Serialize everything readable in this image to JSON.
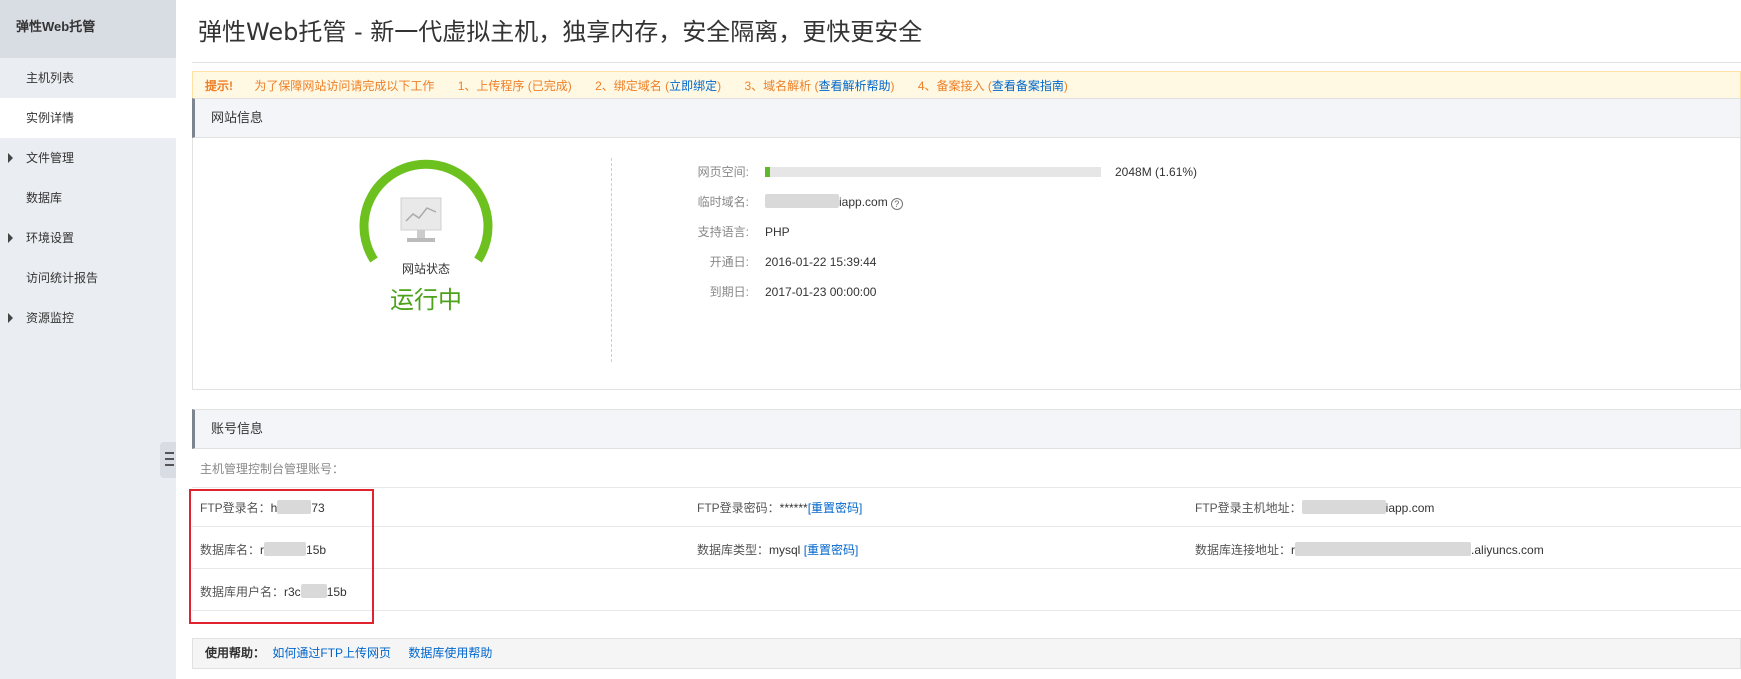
{
  "sidebar": {
    "title": "弹性Web托管",
    "items": [
      {
        "label": "主机列表",
        "caret": false,
        "active": false
      },
      {
        "label": "实例详情",
        "caret": false,
        "active": true
      },
      {
        "label": "文件管理",
        "caret": true,
        "active": false
      },
      {
        "label": "数据库",
        "caret": false,
        "active": false
      },
      {
        "label": "环境设置",
        "caret": true,
        "active": false
      },
      {
        "label": "访问统计报告",
        "caret": false,
        "active": false
      },
      {
        "label": "资源监控",
        "caret": true,
        "active": false
      }
    ]
  },
  "header": {
    "title": "弹性Web托管 - 新一代虚拟主机，独享内存，安全隔离，更快更安全"
  },
  "notice": {
    "label": "提示!",
    "intro": "为了保障网站访问请完成以下工作",
    "step1": "1、上传程序 (已完成)",
    "step2_prefix": "2、绑定域名 (",
    "step2_link": "立即绑定",
    "step3_prefix": "3、域名解析 (",
    "step3_link": "查看解析帮助",
    "step4_prefix": "4、备案接入 (",
    "step4_link": "查看备案指南",
    "close_paren": ")"
  },
  "site_info": {
    "heading": "网站信息",
    "status_label": "网站状态",
    "status_value": "运行中",
    "status_color": "#4da21c",
    "space_label": "网页空间:",
    "space_text": "2048M (1.61%)",
    "space_used_percent": 1.61,
    "domain_label": "临时域名:",
    "domain_suffix": "iapp.com",
    "domain_help": "?",
    "lang_label": "支持语言:",
    "lang_value": "PHP",
    "open_label": "开通日:",
    "open_value": "2016-01-22 15:39:44",
    "expire_label": "到期日:",
    "expire_value": "2017-01-23 00:00:00"
  },
  "account": {
    "heading": "账号信息",
    "console_label": "主机管理控制台管理账号：",
    "ftp_user_label": "FTP登录名：",
    "ftp_user_prefix": "h",
    "ftp_user_suffix": "73",
    "ftp_pwd_label": "FTP登录密码：",
    "ftp_pwd_value": "******",
    "reset_label": "[重置密码]",
    "ftp_host_label": "FTP登录主机地址：",
    "ftp_host_suffix": "iapp.com",
    "db_name_label": "数据库名：",
    "db_name_prefix": "r",
    "db_name_suffix": "15b",
    "db_type_label": "数据库类型：",
    "db_type_value": "mysql",
    "db_host_label": "数据库连接地址：",
    "db_host_prefix": "r",
    "db_host_suffix": ".aliyuncs.com",
    "db_user_label": "数据库用户名：",
    "db_user_prefix": "r3c",
    "db_user_suffix": "15b"
  },
  "help": {
    "label": "使用帮助：",
    "link1": "如何通过FTP上传网页",
    "link2": "数据库使用帮助"
  }
}
